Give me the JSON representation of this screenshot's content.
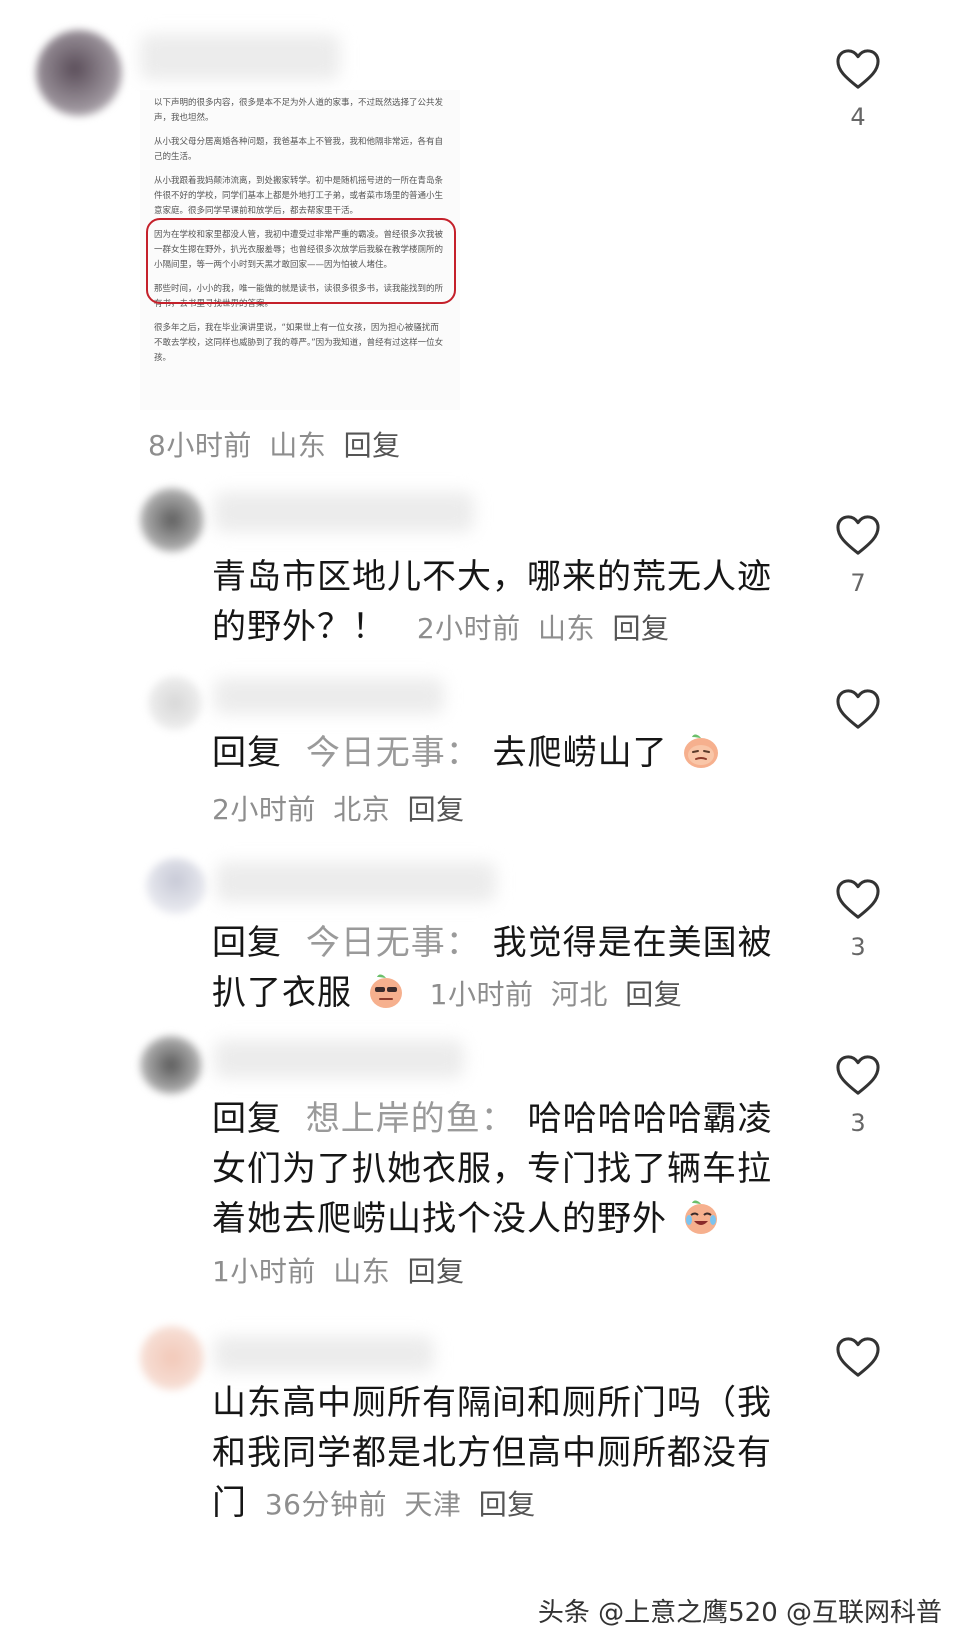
{
  "comments": [
    {
      "doc_paragraphs": [
        "以下声明的很多内容，很多是本不足为外人道的家事，不过既然选择了公共发声，我也坦然。",
        "从小我父母分居离婚各种问题，我爸基本上不管我，我和他隔非常远，各有自己的生活。",
        "从小我跟着我妈颠沛流离，到处搬家转学。初中是随机摇号进的一所在青岛条件很不好的学校，同学们基本上都是外地打工子弟，或者菜市场里的普通小生意家庭。很多同学早课前和放学后，都去帮家里干活。",
        "因为在学校和家里都没人管，我初中遭受过非常严重的霸凌。曾经很多次我被一群女生摁在野外，扒光衣服羞辱；也曾经很多次放学后我躲在教学楼厕所的小隔间里，等一两个小时到天黑才敢回家——因为怕被人堵住。",
        "那些时间，小小的我，唯一能做的就是读书，读很多很多书，读我能找到的所有书，去书里寻找世界的答案。",
        "很多年之后，我在毕业演讲里说，“如果世上有一位女孩，因为担心被骚扰而不敢去学校，这同样也威胁到了我的尊严。”因为我知道，曾经有过这样一位女孩。"
      ],
      "time": "8小时前",
      "location": "山东",
      "reply_label": "回复",
      "likes": "4"
    },
    {
      "text": "青岛市区地儿不大，哪来的荒无人迹的野外？！",
      "line1": "青岛市区地儿不大，哪来的荒无人迹",
      "line2": "的野外？！",
      "time": "2小时前",
      "location": "山东",
      "reply_label": "回复",
      "likes": "7"
    },
    {
      "prefix": "回复",
      "target": "今日无事：",
      "text": "去爬崂山了",
      "emoji": "peach-sly-emoji",
      "time": "2小时前",
      "location": "北京",
      "reply_label": "回复",
      "likes": ""
    },
    {
      "prefix": "回复",
      "target": "今日无事：",
      "line1": "我觉得是在美国被",
      "line2": "扒了衣服",
      "emoji": "peach-smug-emoji",
      "time": "1小时前",
      "location": "河北",
      "reply_label": "回复",
      "likes": "3"
    },
    {
      "prefix": "回复",
      "target": "想上岸的鱼：",
      "line1": "哈哈哈哈哈霸凌",
      "line2": "女们为了扒她衣服，专门找了辆车拉",
      "line3": "着她去爬崂山找个没人的野外",
      "emoji": "peach-laugh-cry-emoji",
      "time": "1小时前",
      "location": "山东",
      "reply_label": "回复",
      "likes": "3"
    },
    {
      "line1": "山东高中厕所有隔间和厕所门吗（我",
      "line2": "和我同学都是北方但高中厕所都没有",
      "line3": "门",
      "time": "36分钟前",
      "location": "天津",
      "reply_label": "回复",
      "likes": ""
    }
  ],
  "watermark": "头条 @上意之鹰520 @互联网科普"
}
